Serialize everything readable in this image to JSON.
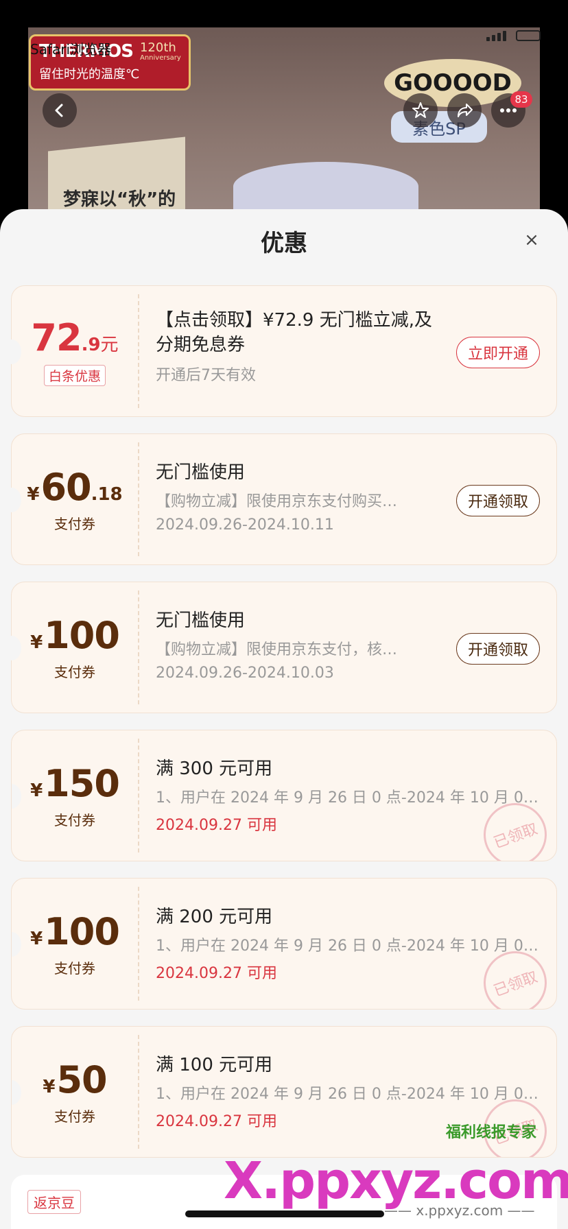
{
  "browser": {
    "label": "Safari浏览器"
  },
  "product": {
    "brand": "THERMOS",
    "anniversary_number": "120th",
    "anniversary_text": "Anniversary",
    "slogan": "留住时光的温度℃",
    "bubble_text": "GOOOOD",
    "sp_tag": "素色SP",
    "box_text": "梦寐以“秋”的",
    "nav_badge": "83"
  },
  "sheet": {
    "title": "优惠",
    "close": "×"
  },
  "coupons": [
    {
      "amount_main": "72",
      "amount_dec": ".9",
      "amount_unit": "元",
      "tag": "白条优惠",
      "title": "【点击领取】¥72.9 无门槛立减,及分期免息券",
      "date": "开通后7天有效",
      "button": "立即开通"
    },
    {
      "yen": "¥",
      "amount_main": "60",
      "amount_dec": ".18",
      "sub": "支付券",
      "title": "无门槛使用",
      "desc": "【购物立减】限使用京东支付购买…",
      "date": "2024.09.26-2024.10.11",
      "button": "开通领取"
    },
    {
      "yen": "¥",
      "amount_main": "100",
      "sub": "支付券",
      "title": "无门槛使用",
      "desc": "【购物立减】限使用京东支付，核…",
      "date": "2024.09.26-2024.10.03",
      "button": "开通领取"
    },
    {
      "yen": "¥",
      "amount_main": "150",
      "sub": "支付券",
      "title": "满 300 元可用",
      "desc": "1、用户在 2024 年 9 月 26 日 0 点-2024 年 10 月 01…",
      "date": "2024.09.27 可用",
      "stamp": "已领取"
    },
    {
      "yen": "¥",
      "amount_main": "100",
      "sub": "支付券",
      "title": "满 200 元可用",
      "desc": "1、用户在 2024 年 9 月 26 日 0 点-2024 年 10 月 01…",
      "date": "2024.09.27 可用",
      "stamp": "已领取"
    },
    {
      "yen": "¥",
      "amount_main": "50",
      "sub": "支付券",
      "title": "满 100 元可用",
      "desc": "1、用户在 2024 年 9 月 26 日 0 点-2024 年 10 月 01…",
      "date": "2024.09.27 可用",
      "stamp": "已领取"
    }
  ],
  "bottom": {
    "tag": "返京豆"
  },
  "watermark": {
    "logo": "X.ppxyz.com",
    "site": "—— x.ppxyz.com ——",
    "brand": "福利线报专家"
  },
  "colors": {
    "accent_red": "#d9353f",
    "brown": "#5a2d0c",
    "card_bg": "#fdf6ef"
  },
  "icons": [
    "back-icon",
    "star-icon",
    "share-icon",
    "more-icon",
    "close-icon"
  ]
}
